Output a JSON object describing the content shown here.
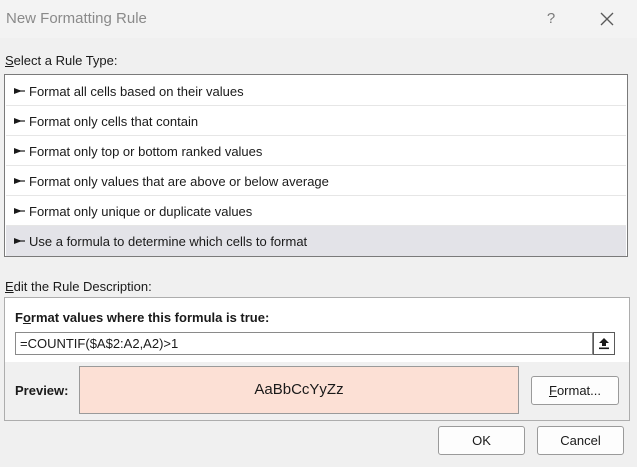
{
  "window": {
    "title": "New Formatting Rule",
    "help_label": "?"
  },
  "rule_type": {
    "label_first": "S",
    "label_rest": "elect a Rule Type:",
    "items": [
      {
        "label": "Format all cells based on their values",
        "selected": false
      },
      {
        "label": "Format only cells that contain",
        "selected": false
      },
      {
        "label": "Format only top or bottom ranked values",
        "selected": false
      },
      {
        "label": "Format only values that are above or below average",
        "selected": false
      },
      {
        "label": "Format only unique or duplicate values",
        "selected": false
      },
      {
        "label": "Use a formula to determine which cells to format",
        "selected": true
      }
    ]
  },
  "description": {
    "label_first": "E",
    "label_rest": "dit the Rule Description:",
    "formula_label_first": "F",
    "formula_label_o": "o",
    "formula_label_rest": "rmat values where this formula is true:",
    "formula_value": "=COUNTIF($A$2:A2,A2)>1",
    "preview_label": "Preview:",
    "preview_sample": "AaBbCcYyZz",
    "preview_fill": "#fce0d5",
    "format_button_first": "F",
    "format_button_rest": "ormat..."
  },
  "buttons": {
    "ok": "OK",
    "cancel": "Cancel"
  }
}
